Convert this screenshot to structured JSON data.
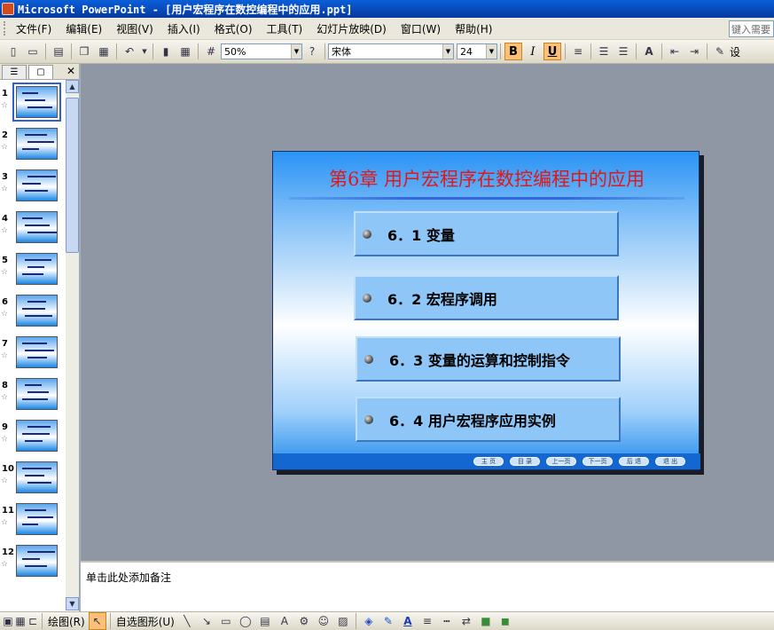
{
  "window": {
    "title": "Microsoft PowerPoint - [用户宏程序在数控编程中的应用.ppt]"
  },
  "menu": {
    "items": [
      "文件(F)",
      "编辑(E)",
      "视图(V)",
      "插入(I)",
      "格式(O)",
      "工具(T)",
      "幻灯片放映(D)",
      "窗口(W)",
      "帮助(H)"
    ],
    "help_placeholder": "键入需要"
  },
  "toolbar": {
    "zoom": "50%",
    "font": "宋体",
    "size": "24",
    "bold": "B",
    "italic": "I",
    "underline": "U",
    "design_label": "设"
  },
  "panel": {
    "slide_numbers": [
      "1",
      "2",
      "3",
      "4",
      "5",
      "6",
      "7",
      "8",
      "9",
      "10",
      "11",
      "12"
    ],
    "star": "☆"
  },
  "slide": {
    "title": "第6章  用户宏程序在数控编程中的应用",
    "items": [
      "6．1  变量",
      "6．2  宏程序调用",
      "6．3  变量的运算和控制指令",
      "6．4  用户宏程序应用实例"
    ],
    "nav": [
      "主 页",
      "目 录",
      "上一页",
      "下一页",
      "后 退",
      "退 出"
    ]
  },
  "notes": {
    "placeholder": "单击此处添加备注"
  },
  "drawing": {
    "draw_label": "绘图(R)",
    "autoshape_label": "自选图形(U)"
  },
  "colors": {
    "title": "#e21818",
    "accent": "#1467d0"
  }
}
